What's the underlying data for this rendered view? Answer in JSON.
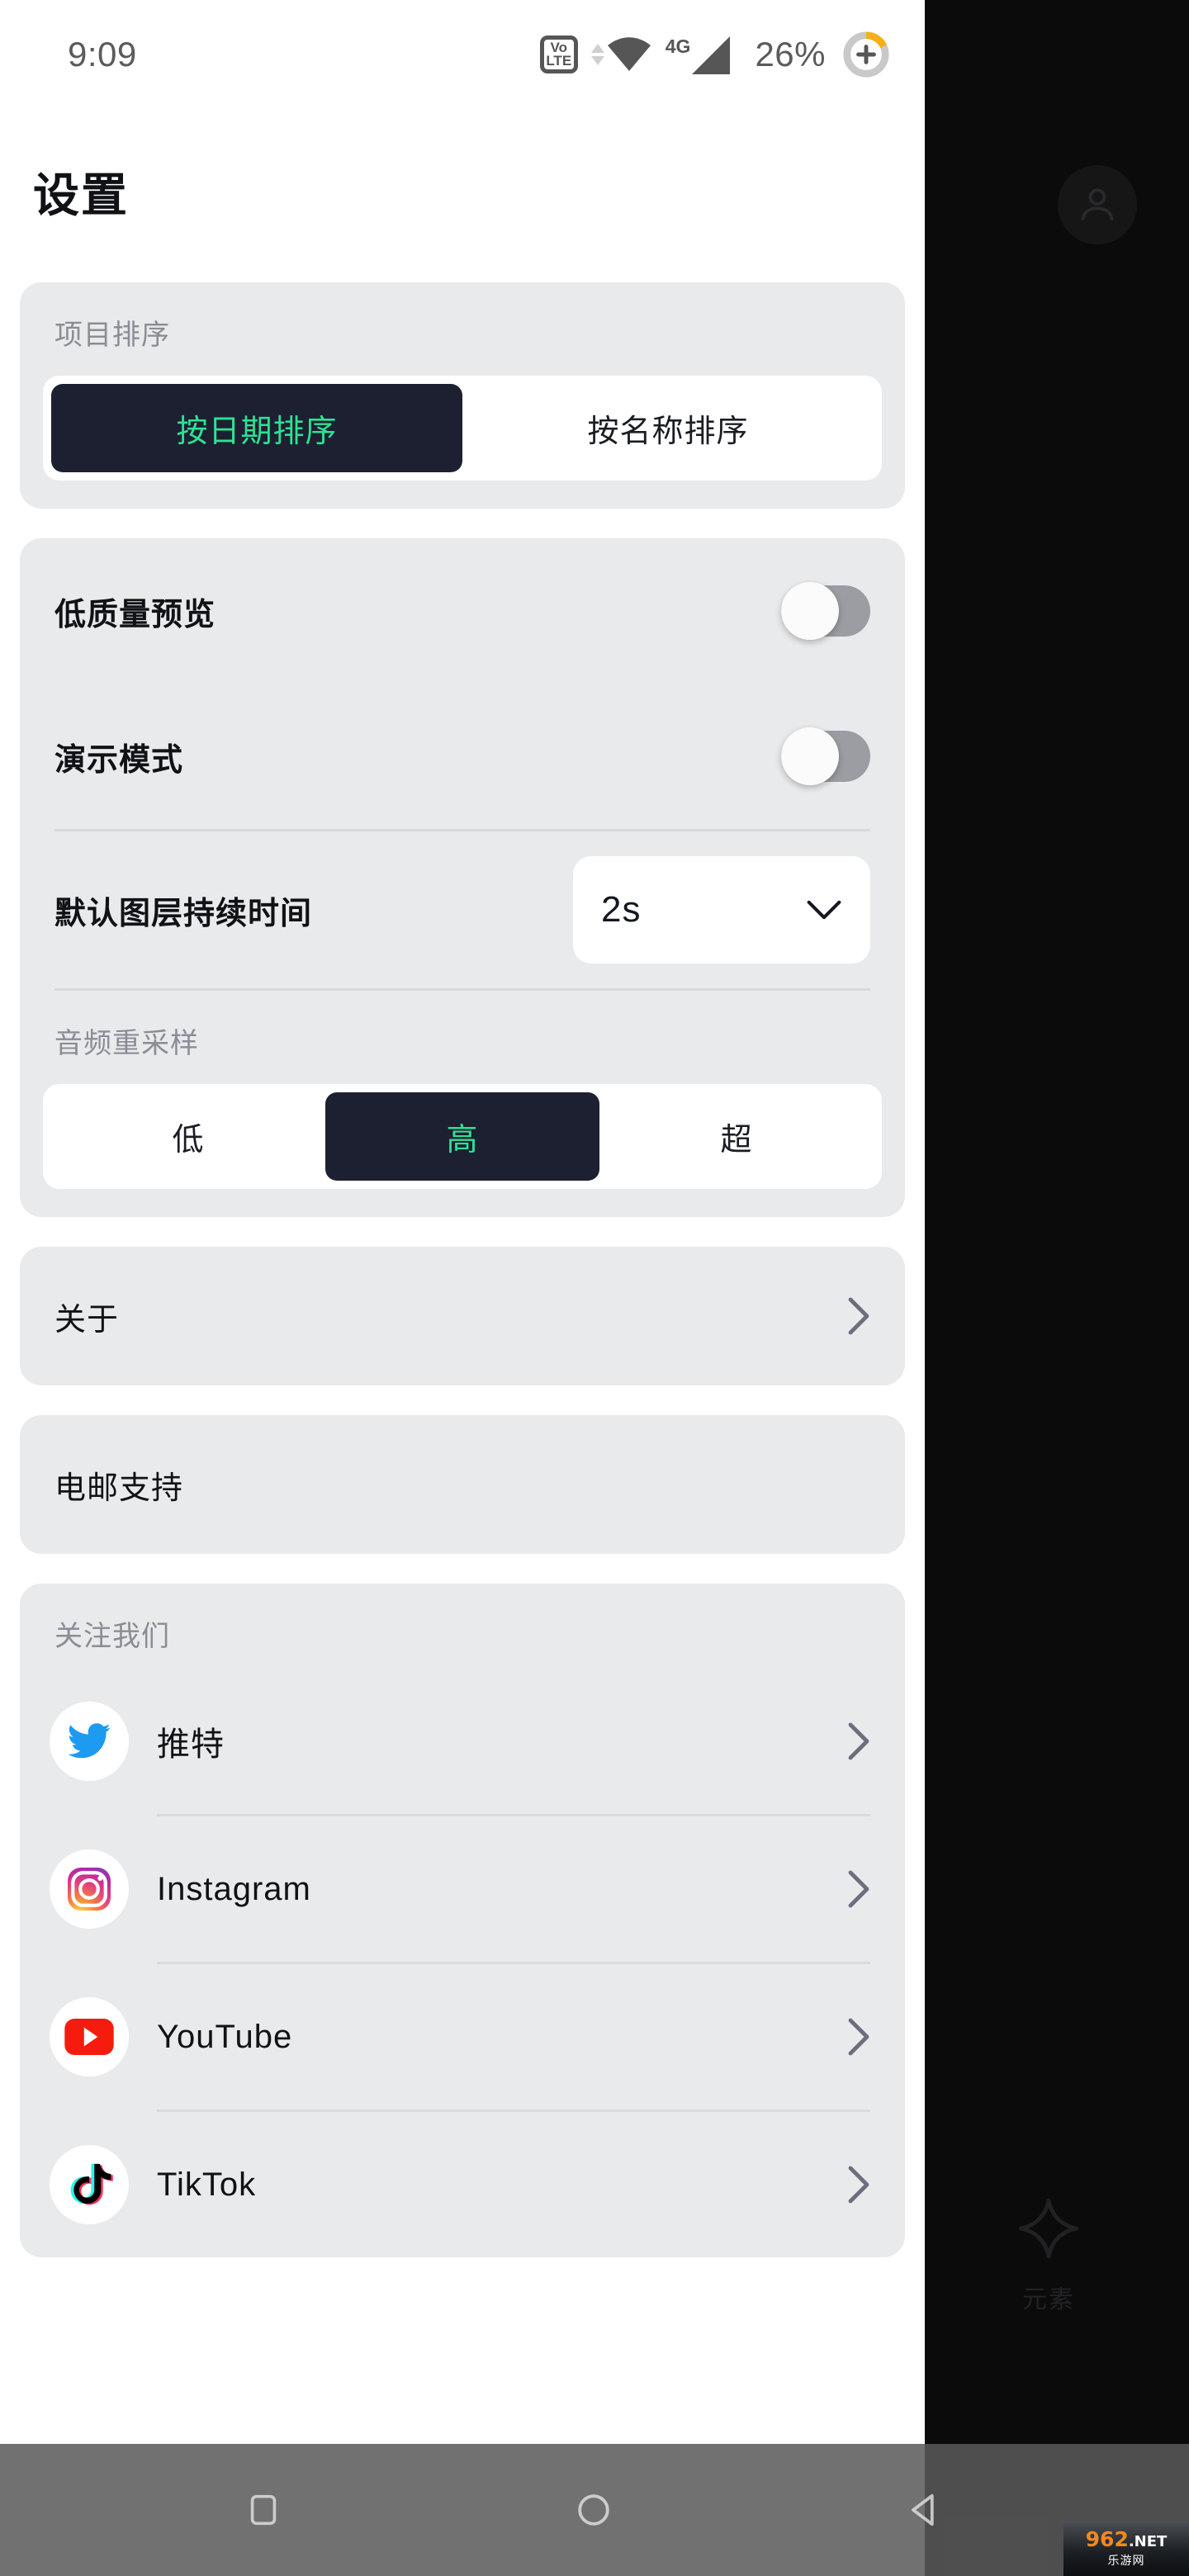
{
  "status_bar": {
    "time": "9:09",
    "volte_top": "Vo",
    "volte_bottom": "LTE",
    "network": "4G",
    "battery_percent": "26%",
    "icons": [
      "volte-icon",
      "wifi-icon",
      "signal-4g-icon",
      "battery-charging-icon"
    ]
  },
  "header": {
    "title": "设置"
  },
  "sections": {
    "project_sort": {
      "label": "项目排序",
      "options": [
        {
          "label": "按日期排序",
          "selected": true
        },
        {
          "label": "按名称排序",
          "selected": false
        }
      ]
    },
    "preferences": {
      "low_quality_preview": {
        "label": "低质量预览",
        "state": "off"
      },
      "demo_mode": {
        "label": "演示模式",
        "state": "off"
      },
      "default_layer_duration": {
        "label": "默认图层持续时间",
        "value": "2s"
      },
      "audio_resampling": {
        "label": "音频重采样",
        "options": [
          {
            "label": "低",
            "selected": false
          },
          {
            "label": "高",
            "selected": true
          },
          {
            "label": "超",
            "selected": false
          }
        ]
      }
    },
    "about": {
      "label": "关于"
    },
    "email_support": {
      "label": "电邮支持"
    },
    "follow_us": {
      "label": "关注我们",
      "items": [
        {
          "name": "推特",
          "icon": "twitter-icon"
        },
        {
          "name": "Instagram",
          "icon": "instagram-icon"
        },
        {
          "name": "YouTube",
          "icon": "youtube-icon"
        },
        {
          "name": "TikTok",
          "icon": "tiktok-icon"
        }
      ]
    }
  },
  "background_app": {
    "avatar": "account-avatar-icon",
    "elements_tab": {
      "label": "元素",
      "icon": "sparkle-star-icon"
    }
  },
  "nav_bar": {
    "recents": "square-recents-icon",
    "home": "circle-home-icon",
    "back": "triangle-back-icon"
  },
  "watermark": {
    "digits_962": "962",
    "tld": ".NET",
    "sub": "乐游网"
  },
  "colors": {
    "accent_green": "#2fe193",
    "segment_dark": "#1c2031",
    "card_bg": "#e9eaec",
    "sheet_bg": "#ffffff",
    "text_primary": "#101216",
    "text_muted": "#8a8d94",
    "chevron": "#6b6f7d",
    "battery_orange": "#f5b game"
  }
}
